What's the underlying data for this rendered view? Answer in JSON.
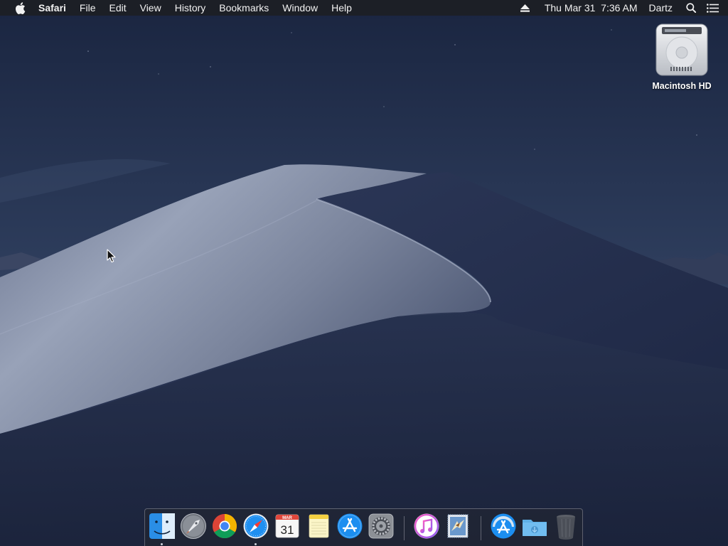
{
  "menubar": {
    "app_name": "Safari",
    "items": [
      "File",
      "Edit",
      "View",
      "History",
      "Bookmarks",
      "Window",
      "Help"
    ],
    "status": {
      "datetime": "Thu Mar 31  7:36 AM",
      "user": "Dartz"
    },
    "icons": [
      "apple-logo-icon",
      "eject-icon",
      "spotlight-search-icon",
      "notification-center-icon"
    ]
  },
  "desktop": {
    "icons": [
      {
        "label": "Macintosh HD",
        "icon": "hard-drive-icon"
      }
    ]
  },
  "dock": {
    "apps": [
      {
        "name": "Finder",
        "icon": "finder-icon",
        "running": true
      },
      {
        "name": "Launchpad",
        "icon": "launchpad-icon",
        "running": false
      },
      {
        "name": "Google Chrome",
        "icon": "chrome-icon",
        "running": false
      },
      {
        "name": "Safari",
        "icon": "safari-icon",
        "running": true
      },
      {
        "name": "Calendar",
        "icon": "calendar-icon",
        "running": false,
        "month": "MAR",
        "day": "31"
      },
      {
        "name": "Notes",
        "icon": "notes-icon",
        "running": false
      },
      {
        "name": "App Store",
        "icon": "app-store-icon",
        "running": false
      },
      {
        "name": "System Preferences",
        "icon": "system-preferences-icon",
        "running": false
      },
      {
        "name": "iTunes",
        "icon": "itunes-icon",
        "running": false
      },
      {
        "name": "Mail",
        "icon": "mail-icon",
        "running": false
      },
      {
        "name": "Applications",
        "icon": "applications-folder-icon",
        "running": false
      },
      {
        "name": "Downloads",
        "icon": "downloads-folder-icon",
        "running": false
      },
      {
        "name": "Trash",
        "icon": "trash-icon",
        "running": false
      }
    ]
  },
  "colors": {
    "menubar_bg": "#1c1e24",
    "sky_top": "#1b2744",
    "sky_bottom": "#3c4d6c",
    "dune_light": "#8e98ae",
    "dune_dark": "#1c2642"
  }
}
